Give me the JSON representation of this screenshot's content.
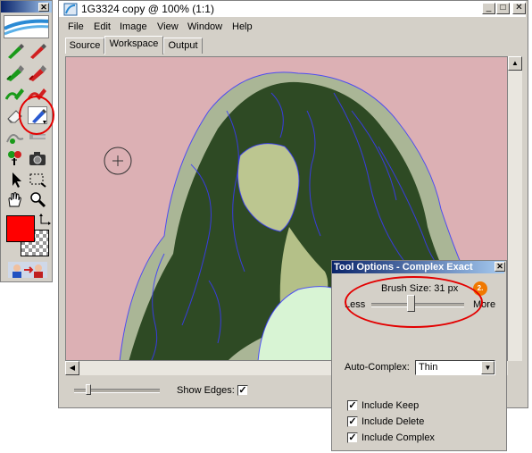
{
  "toolbox": {
    "tools": [
      "keep-brush",
      "delete-brush",
      "keep-marker",
      "delete-marker",
      "keep-fill",
      "delete-fill",
      "eraser",
      "complex-brush",
      "keep-highlight",
      "delete-highlight",
      "eyedropper",
      "snapshot",
      "arrow-select",
      "rect-select",
      "hand",
      "zoom"
    ],
    "foreground_color": "#ff0000",
    "marker_1": "1."
  },
  "window": {
    "title": "1G3324 copy @ 100% (1:1)",
    "buttons": {
      "minimize": "_",
      "maximize": "□",
      "close": "✕"
    },
    "menu": [
      "File",
      "Edit",
      "Image",
      "View",
      "Window",
      "Help"
    ],
    "tabs": [
      "Source",
      "Workspace",
      "Output"
    ],
    "active_tab": "Workspace"
  },
  "status": {
    "show_edges_label": "Show Edges:",
    "show_edges_checked": true,
    "check_mark": "✓"
  },
  "tool_options": {
    "title": "Tool Options - Complex Exact",
    "close": "✕",
    "brush_size_label": "Brush Size: 31 px",
    "marker_2": "2.",
    "less_label": "Less",
    "more_label": "More",
    "auto_complex_label": "Auto-Complex:",
    "auto_complex_value": "Thin",
    "dropdown_arrow": "▼",
    "checkboxes": [
      {
        "label": "Include Keep",
        "checked": true
      },
      {
        "label": "Include Delete",
        "checked": true
      },
      {
        "label": "Include Complex",
        "checked": true
      }
    ]
  },
  "colors": {
    "canvas_background": "#dcb0b4",
    "hair_highlight": "#2e4a24",
    "edge_lines": "#3a3aff",
    "annotation_red": "#e30000",
    "badge_orange": "#f07800"
  }
}
